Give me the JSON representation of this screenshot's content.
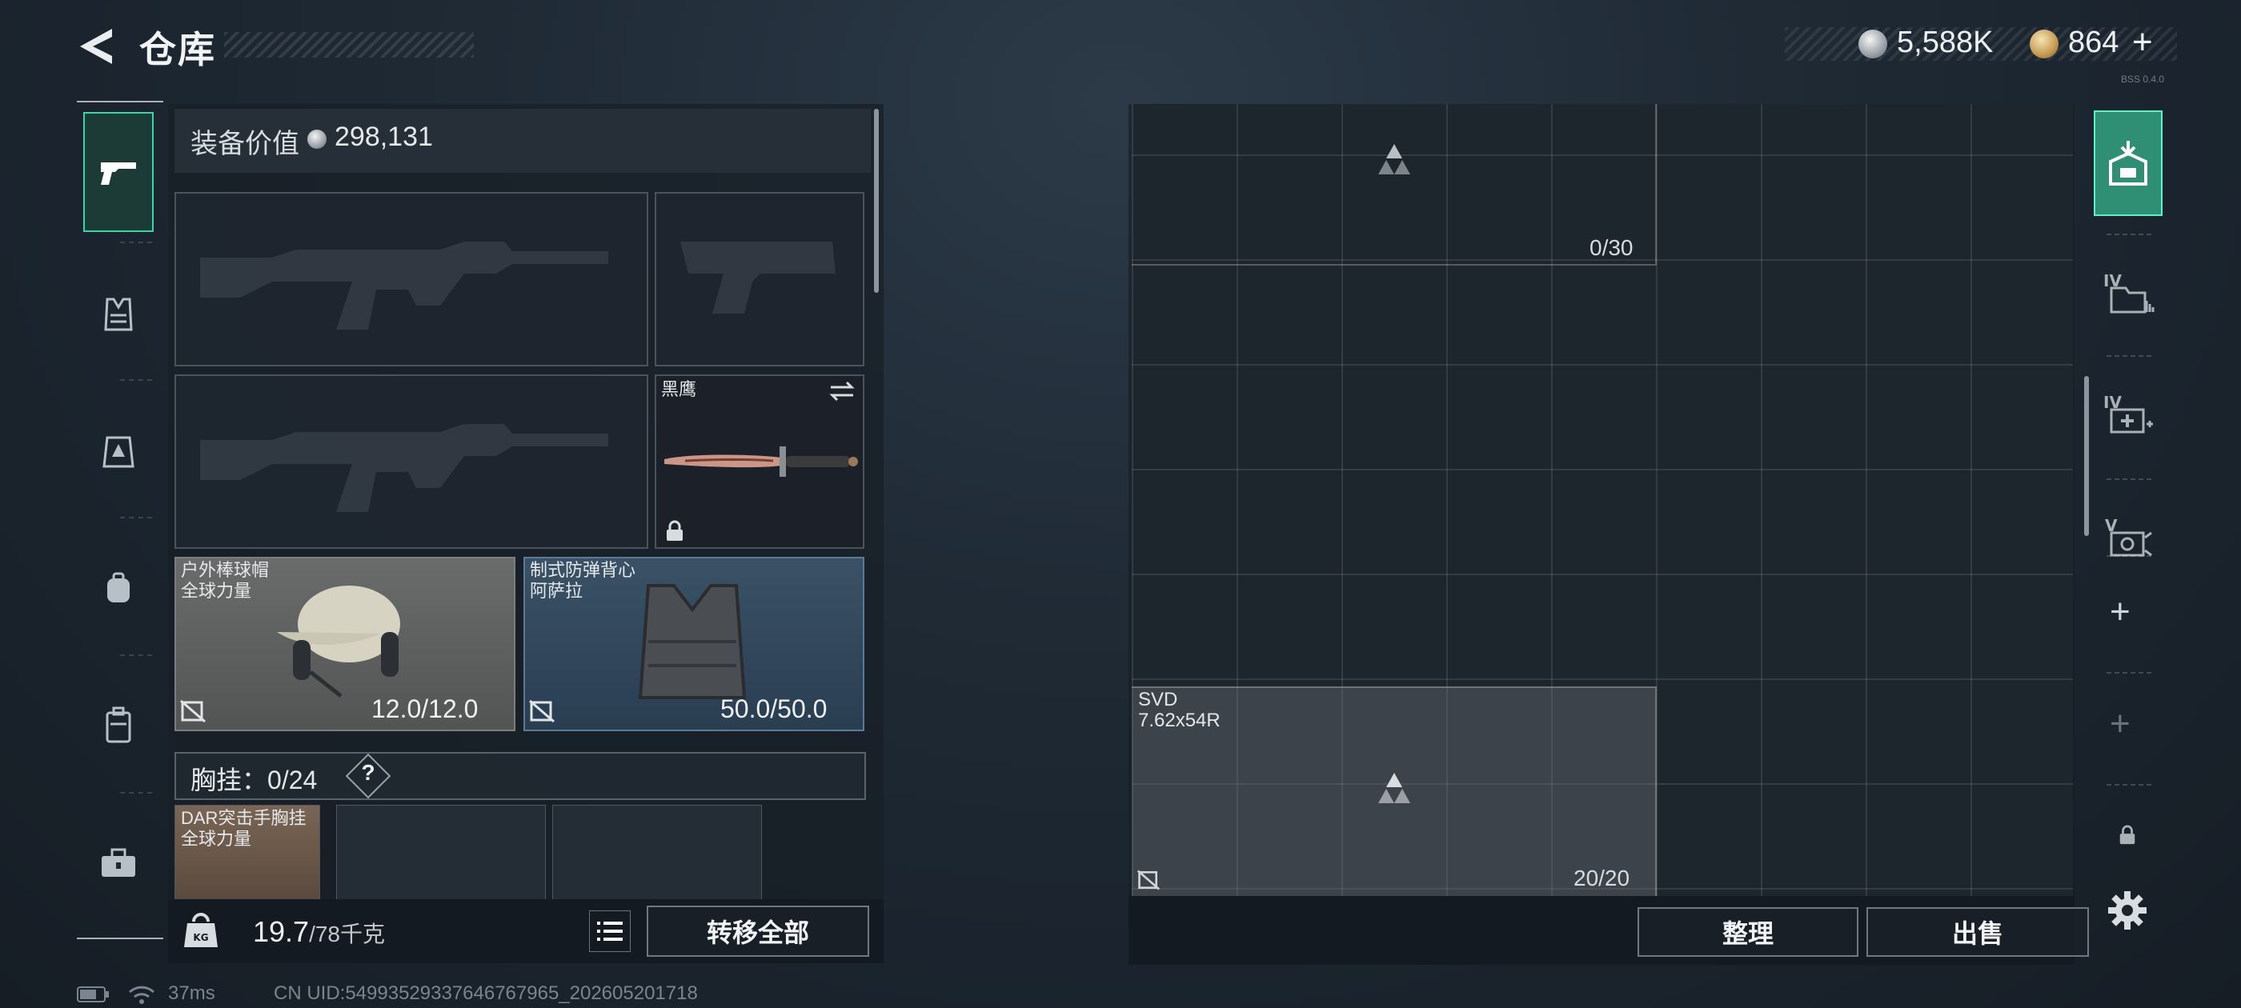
{
  "header": {
    "title": "仓库",
    "currency_silver": "5,588K",
    "currency_gold": "864",
    "add_label": "+",
    "tiny_version": "BSS 0.4.0"
  },
  "left_sidebar": {
    "tabs": [
      {
        "name": "pistol-icon",
        "active": true
      },
      {
        "name": "vest-icon",
        "active": false
      },
      {
        "name": "rig-icon",
        "active": false
      },
      {
        "name": "backpack-icon",
        "active": false
      },
      {
        "name": "case-icon",
        "active": false
      },
      {
        "name": "toolbox-icon",
        "active": false
      }
    ]
  },
  "equipment": {
    "value_label": "装备价值",
    "value": "298,131",
    "knife_name": "黑鹰",
    "helmet": {
      "line1": "户外棒球帽",
      "line2": "全球力量",
      "durability": "12.0/12.0"
    },
    "armor": {
      "line1": "制式防弹背心",
      "line2": "阿萨拉",
      "durability": "50.0/50.0"
    },
    "rig_label": "胸挂：",
    "rig_count": "0/24",
    "rig_help": "?",
    "rig_item": {
      "line1": "DAR突击手胸挂",
      "line2": "全球力量"
    }
  },
  "bottom_left": {
    "weight": "19.7",
    "weight_max": "/78千克",
    "transfer_all": "转移全部"
  },
  "storage": {
    "section1_capacity": "0/30",
    "item_name": "SVD",
    "item_ammo": "7.62x54R",
    "section2_capacity": "20/20",
    "sort_button": "整理",
    "sell_button": "出售"
  },
  "right_sidebar": {
    "tab_labels": [
      "IV",
      "IV",
      "V"
    ],
    "plus_1": "+",
    "plus_2": "+"
  },
  "status_bar": {
    "ping": "37ms",
    "uid": "CN UID:549935293376467679​65_202605201718"
  },
  "colors": {
    "accent_green": "#3bd6a6",
    "panel_bg": "#171e26",
    "armor_slot": "#2a3e52"
  }
}
